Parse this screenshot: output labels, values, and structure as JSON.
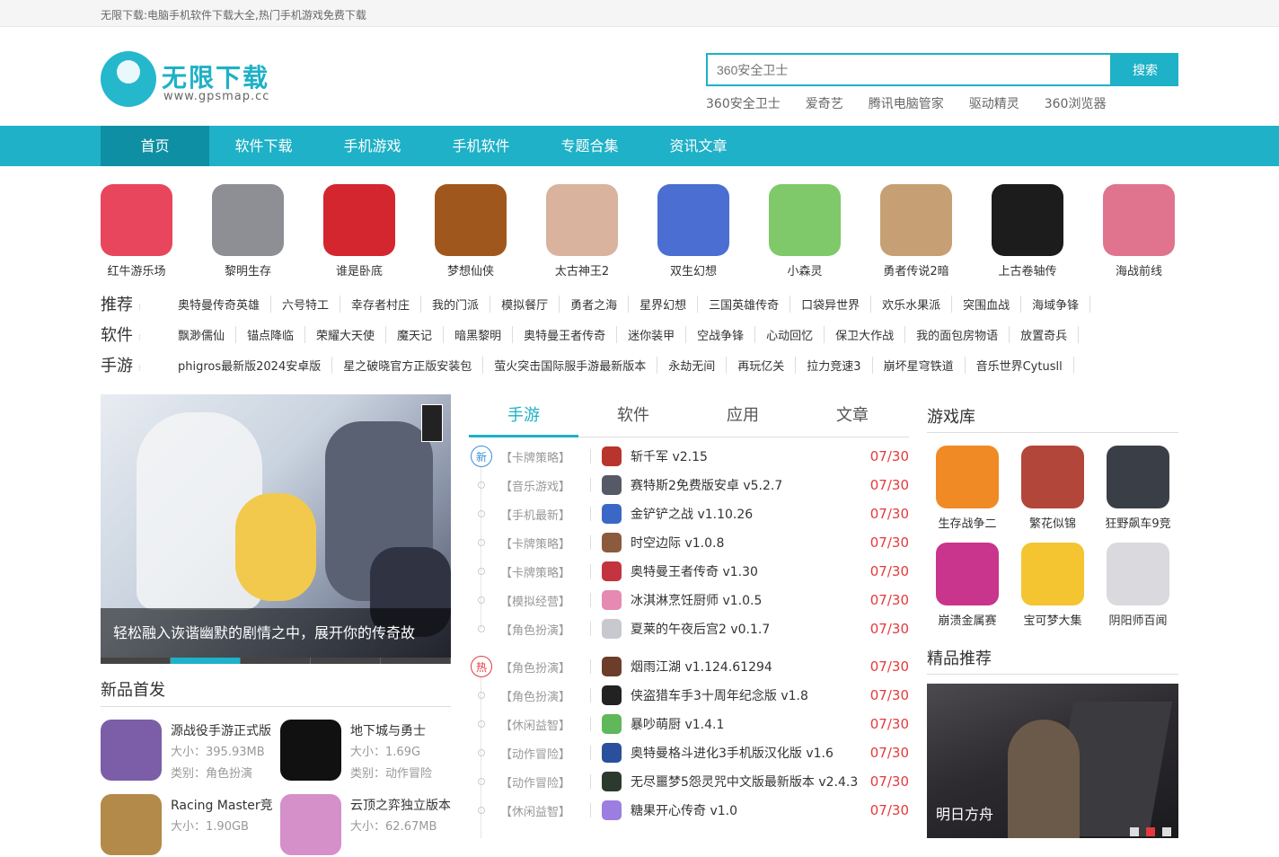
{
  "topbar": {
    "text": "无限下载:电脑手机软件下载大全,热门手机游戏免费下载"
  },
  "header": {
    "logo_text": "无限下载",
    "logo_url": "www.gpsmap.cc",
    "search_placeholder": "360安全卫士",
    "search_button": "搜索",
    "hot_links": [
      "360安全卫士",
      "爱奇艺",
      "腾讯电脑管家",
      "驱动精灵",
      "360浏览器"
    ]
  },
  "nav": [
    "首页",
    "软件下载",
    "手机游戏",
    "手机软件",
    "专题合集",
    "资讯文章"
  ],
  "featured_games": [
    {
      "name": "红牛游乐场",
      "color": "#e8465c"
    },
    {
      "name": "黎明生存",
      "color": "#8d8f94"
    },
    {
      "name": "谁是卧底",
      "color": "#d4262f"
    },
    {
      "name": "梦想仙侠",
      "color": "#a0571d"
    },
    {
      "name": "太古神王2",
      "color": "#d9b39e"
    },
    {
      "name": "双生幻想",
      "color": "#4a6ed1"
    },
    {
      "name": "小森灵",
      "color": "#7fc96a"
    },
    {
      "name": "勇者传说2暗",
      "color": "#c6a074"
    },
    {
      "name": "上古卷轴传",
      "color": "#1c1c1c"
    },
    {
      "name": "海战前线",
      "color": "#e0748e"
    }
  ],
  "tag_rows": [
    {
      "label": "推荐",
      "tags": [
        "奥特曼传奇英雄",
        "六号特工",
        "幸存者村庄",
        "我的门派",
        "模拟餐厅",
        "勇者之海",
        "星界幻想",
        "三国英雄传奇",
        "口袋异世界",
        "欢乐水果派",
        "突围血战",
        "海域争锋"
      ]
    },
    {
      "label": "软件",
      "tags": [
        "飘渺儒仙",
        "锚点降临",
        "荣耀大天使",
        "魔天记",
        "暗黑黎明",
        "奥特曼王者传奇",
        "迷你装甲",
        "空战争锋",
        "心动回忆",
        "保卫大作战",
        "我的面包房物语",
        "放置奇兵"
      ]
    },
    {
      "label": "手游",
      "tags": [
        "phigros最新版2024安卓版",
        "星之破晓官方正版安装包",
        "萤火突击国际服手游最新版本",
        "永劫无间",
        "再玩亿关",
        "拉力竞速3",
        "崩坏星穹铁道",
        "音乐世界Cytusll"
      ]
    }
  ],
  "banner": {
    "caption": "轻松融入诙谐幽默的剧情之中，展开你的传奇故"
  },
  "new_release": {
    "title": "新品首发",
    "items": [
      {
        "name": "源战役手游正式版",
        "size_label": "大小：",
        "size": "395.93MB",
        "cat_label": "类别：",
        "cat": "角色扮演",
        "color": "#7b5ea7"
      },
      {
        "name": "地下城与勇士",
        "size_label": "大小：",
        "size": "1.69G",
        "cat_label": "类别：",
        "cat": "动作冒险",
        "color": "#111111"
      },
      {
        "name": "Racing Master竞",
        "size_label": "大小：",
        "size": "1.90GB",
        "color": "#b38a4a"
      },
      {
        "name": "云顶之弈独立版本",
        "size_label": "大小：",
        "size": "62.67MB",
        "color": "#d58fc9"
      }
    ]
  },
  "tabs": [
    "手游",
    "软件",
    "应用",
    "文章"
  ],
  "badges": {
    "new": "新",
    "hot": "热"
  },
  "list_new": [
    {
      "cat": "【卡牌策略】",
      "title": "斩千军 v2.15",
      "date": "07/30",
      "color": "#b7352c"
    },
    {
      "cat": "【音乐游戏】",
      "title": "赛特斯2免费版安卓 v5.2.7",
      "date": "07/30",
      "color": "#555a66"
    },
    {
      "cat": "【手机最新】",
      "title": "金铲铲之战 v1.10.26",
      "date": "07/30",
      "color": "#3a68c7"
    },
    {
      "cat": "【卡牌策略】",
      "title": "时空边际 v1.0.8",
      "date": "07/30",
      "color": "#8c5a3c"
    },
    {
      "cat": "【卡牌策略】",
      "title": "奥特曼王者传奇 v1.30",
      "date": "07/30",
      "color": "#c4343f"
    },
    {
      "cat": "【模拟经营】",
      "title": "冰淇淋烹饪厨师 v1.0.5",
      "date": "07/30",
      "color": "#e58ab0"
    },
    {
      "cat": "【角色扮演】",
      "title": "夏莱的午夜后宫2 v0.1.7",
      "date": "07/30",
      "color": "#c7c9cf"
    }
  ],
  "list_hot": [
    {
      "cat": "【角色扮演】",
      "title": "烟雨江湖 v1.124.61294",
      "date": "07/30",
      "color": "#6c3d2a"
    },
    {
      "cat": "【角色扮演】",
      "title": "侠盗猎车手3十周年纪念版 v1.8",
      "date": "07/30",
      "color": "#222222"
    },
    {
      "cat": "【休闲益智】",
      "title": "暴吵萌厨 v1.4.1",
      "date": "07/30",
      "color": "#5fb85a"
    },
    {
      "cat": "【动作冒险】",
      "title": "奥特曼格斗进化3手机版汉化版 v1.6",
      "date": "07/30",
      "color": "#2a4f9c"
    },
    {
      "cat": "【动作冒险】",
      "title": "无尽噩梦5怨灵咒中文版最新版本 v2.4.3",
      "date": "07/30",
      "color": "#2b3a2d"
    },
    {
      "cat": "【休闲益智】",
      "title": "糖果开心传奇 v1.0",
      "date": "07/30",
      "color": "#9b7ee0"
    }
  ],
  "game_library": {
    "title": "游戏库",
    "items": [
      {
        "name": "生存战争二",
        "color": "#f08a24"
      },
      {
        "name": "繁花似锦",
        "color": "#b3463a"
      },
      {
        "name": "狂野飙车9竞",
        "color": "#3a3f47"
      },
      {
        "name": "崩溃金属赛",
        "color": "#c9348c"
      },
      {
        "name": "宝可梦大集",
        "color": "#f4c531"
      },
      {
        "name": "阴阳师百闻",
        "color": "#d9d9de"
      }
    ]
  },
  "featured": {
    "title": "精品推荐",
    "caption": "明日方舟"
  }
}
